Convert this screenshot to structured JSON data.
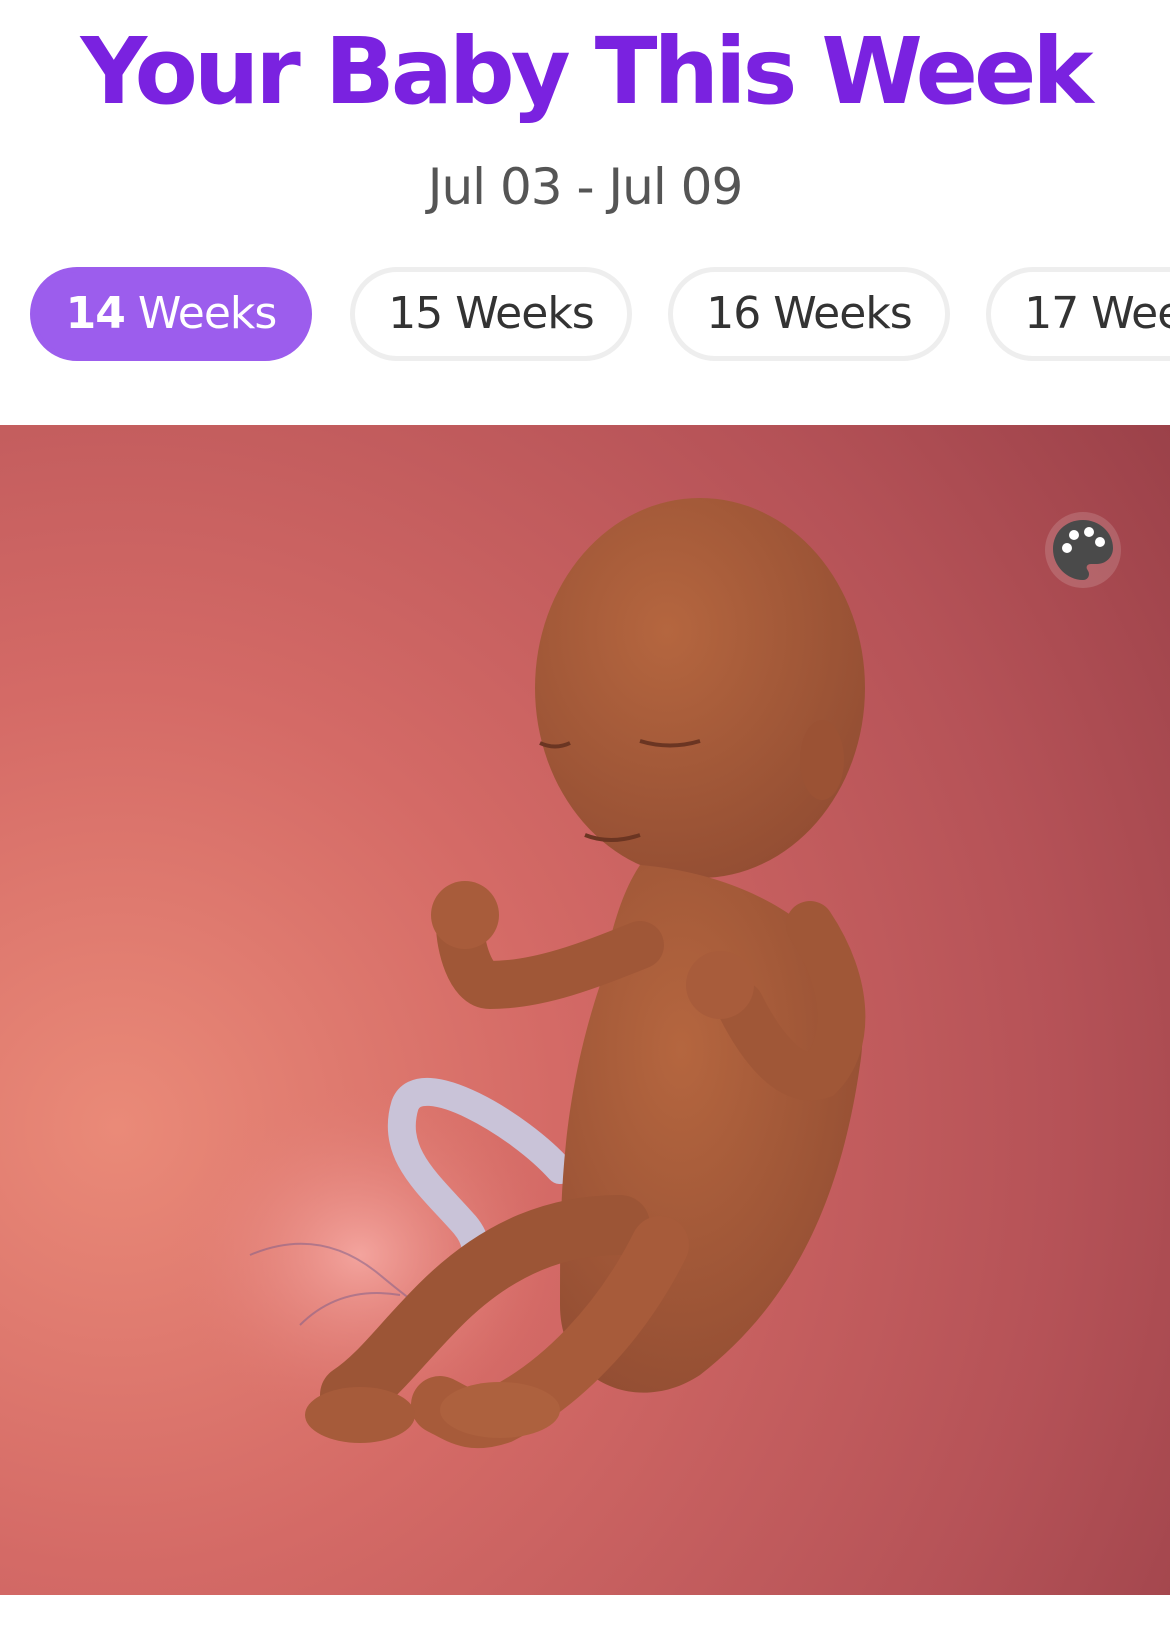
{
  "header": {
    "title": "Your Baby This Week",
    "date_range": "Jul 03 - Jul 09"
  },
  "week_tabs": [
    {
      "number": "14",
      "suffix": " Weeks",
      "active": true
    },
    {
      "number": "15",
      "suffix": " Weeks",
      "active": false
    },
    {
      "number": "16",
      "suffix": " Weeks",
      "active": false
    },
    {
      "number": "17",
      "suffix": " Weeks",
      "active": false
    }
  ],
  "hero": {
    "icon": "palette-icon"
  },
  "colors": {
    "title": "#7a22e0",
    "active_tab": "#9c5ded",
    "background_womb": "#c65d5f",
    "baby_skin": "#a5583b"
  }
}
